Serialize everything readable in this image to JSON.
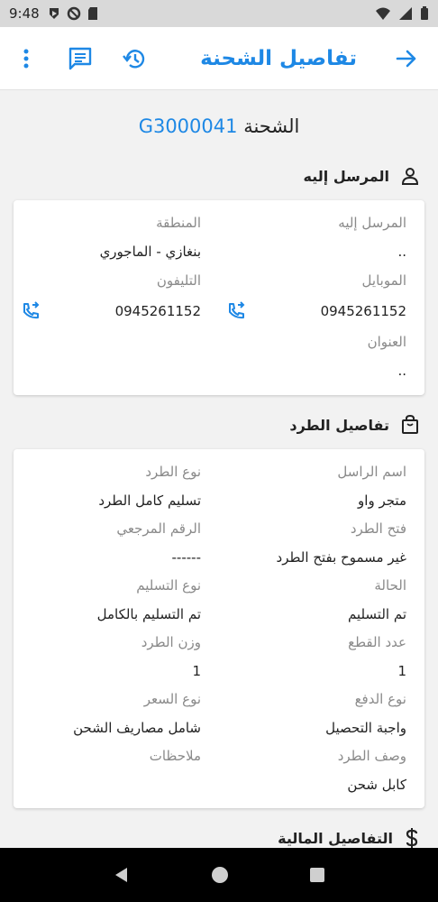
{
  "status_bar": {
    "time": "9:48"
  },
  "app_bar": {
    "title": "تفاصيل الشحنة"
  },
  "shipment": {
    "label": "الشحنة",
    "number": "G3000041"
  },
  "recipient_section": {
    "title": "المرسل إليه",
    "fields": {
      "recipient_label": "المرسل إليه",
      "recipient_value": "..",
      "region_label": "المنطقة",
      "region_value": "بنغازي - الماجوري",
      "mobile_label": "الموبايل",
      "mobile_value": "0945261152",
      "phone_label": "التليفون",
      "phone_value": "0945261152",
      "address_label": "العنوان",
      "address_value": ".."
    }
  },
  "parcel_section": {
    "title": "تفاصيل الطرد",
    "fields": {
      "sender_label": "اسم الراسل",
      "sender_value": "متجر واو",
      "type_label": "نوع الطرد",
      "type_value": "تسليم كامل الطرد",
      "open_label": "فتح الطرد",
      "open_value": "غير مسموح بفتح الطرد",
      "ref_label": "الرقم المرجعي",
      "ref_value": "------",
      "status_label": "الحالة",
      "status_value": "تم التسليم",
      "delivery_label": "نوع التسليم",
      "delivery_value": "تم التسليم بالكامل",
      "pieces_label": "عدد القطع",
      "pieces_value": "1",
      "weight_label": "وزن الطرد",
      "weight_value": "1",
      "payment_label": "نوع الدفع",
      "payment_value": "واجبة التحصيل",
      "price_label": "نوع السعر",
      "price_value": "شامل مصاريف الشحن",
      "desc_label": "وصف الطرد",
      "desc_value": "كابل شحن",
      "notes_label": "ملاحظات"
    }
  },
  "financial_section": {
    "title": "التفاصيل المالية"
  },
  "colors": {
    "accent": "#1e88e5",
    "label": "#8a8a8a",
    "text": "#222222"
  }
}
